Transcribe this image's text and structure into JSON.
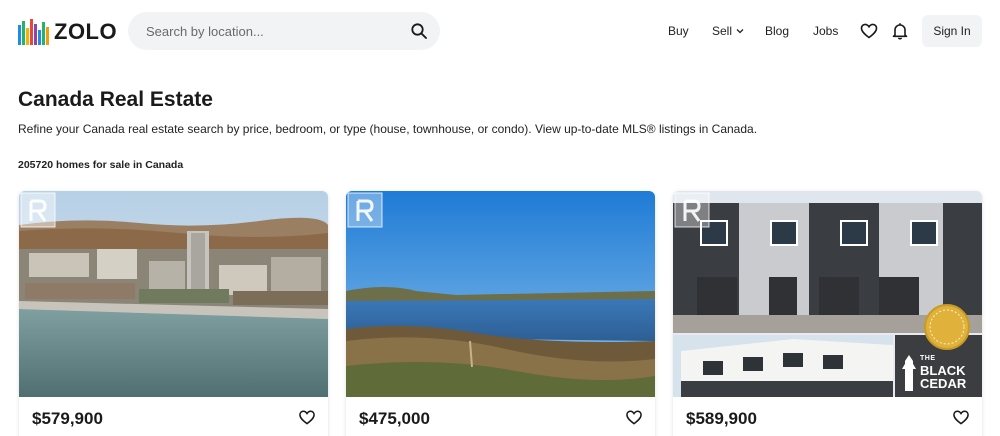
{
  "brand": {
    "name": "ZOLO"
  },
  "search": {
    "placeholder": "Search by location..."
  },
  "nav": {
    "buy": "Buy",
    "sell": "Sell",
    "blog": "Blog",
    "jobs": "Jobs",
    "sign_in": "Sign In"
  },
  "page": {
    "title": "Canada Real Estate",
    "description": "Refine your Canada real estate search by price, bedroom, or type (house, townhouse, or condo). View up-to-date MLS® listings in Canada.",
    "count": "205720 homes for sale in Canada"
  },
  "listings": [
    {
      "price": "$579,900"
    },
    {
      "price": "$475,000"
    },
    {
      "price": "$589,900",
      "badge_lines": [
        "THE",
        "BLACK",
        "CEDAR"
      ]
    }
  ],
  "icons": [
    "logo-icon",
    "search-icon",
    "chevron-down-icon",
    "heart-icon",
    "bell-icon",
    "realtor-icon"
  ]
}
